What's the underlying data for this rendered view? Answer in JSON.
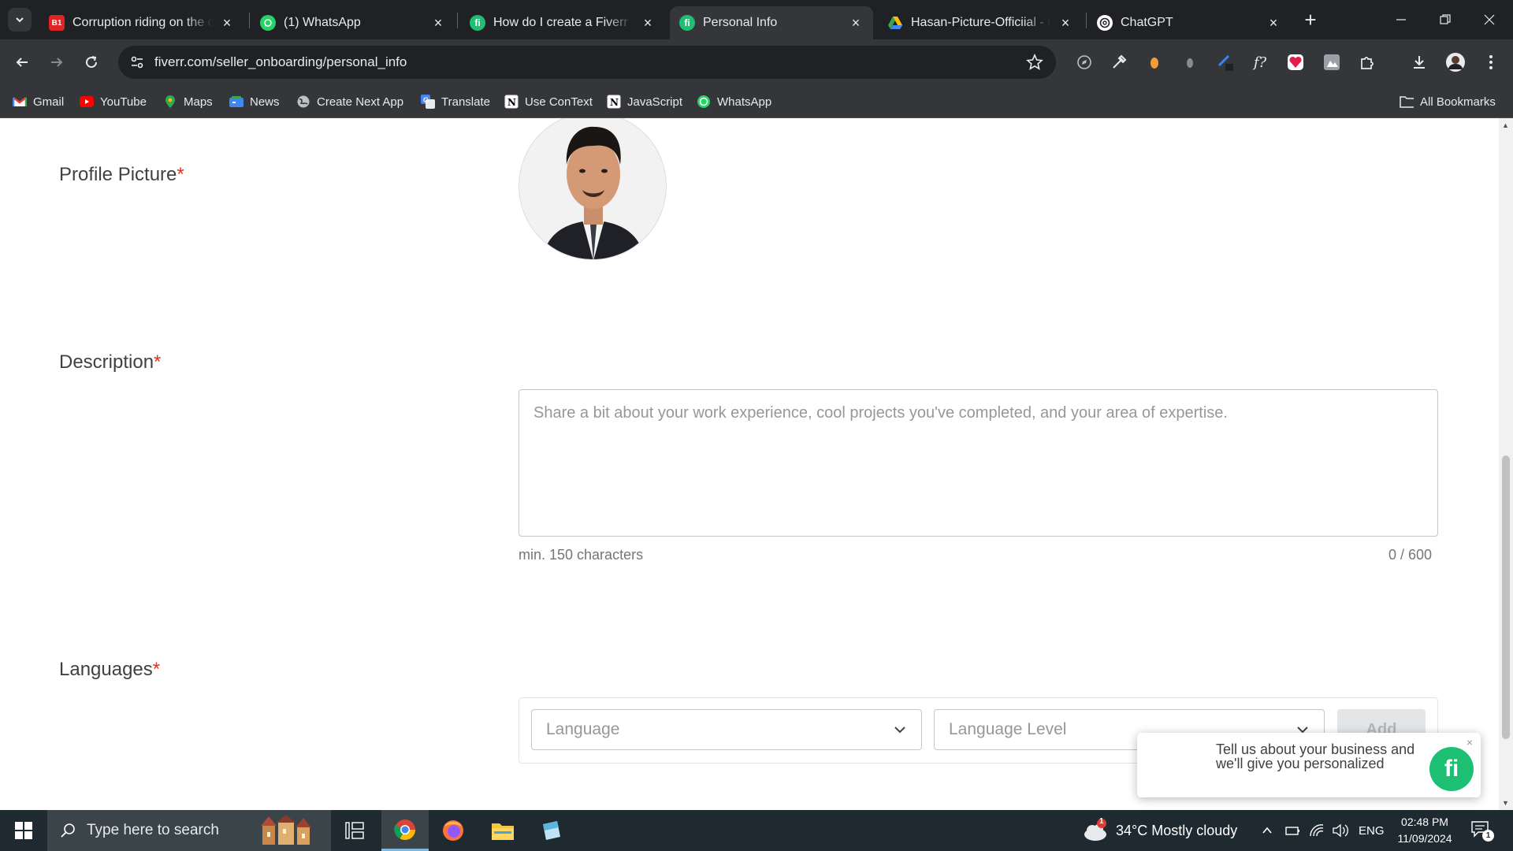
{
  "browser": {
    "tabs": [
      {
        "title": "Corruption riding on the coattails",
        "favicon": "b1-icon"
      },
      {
        "title": "(1) WhatsApp",
        "favicon": "whatsapp-icon"
      },
      {
        "title": "How do I create a Fiverr account",
        "favicon": "fiverr-icon"
      },
      {
        "title": "Personal Info",
        "favicon": "fiverr-icon",
        "active": true
      },
      {
        "title": "Hasan-Picture-Officiial - Google Drive",
        "favicon": "drive-icon"
      },
      {
        "title": "ChatGPT",
        "favicon": "chatgpt-icon"
      }
    ],
    "url": "fiverr.com/seller_onboarding/personal_info",
    "bookmarks": [
      "Gmail",
      "YouTube",
      "Maps",
      "News",
      "Create Next App",
      "Translate",
      "Use ConText",
      "JavaScript",
      "WhatsApp"
    ],
    "all_bookmarks": "All Bookmarks"
  },
  "form": {
    "profile_picture_label": "Profile Picture",
    "description_label": "Description",
    "description_placeholder": "Share a bit about your work experience, cool projects you've completed, and your area of expertise.",
    "description_min": "min. 150 characters",
    "description_counter": "0 / 600",
    "languages_label": "Languages",
    "required_mark": "*",
    "language_placeholder": "Language",
    "language_level_placeholder": "Language Level",
    "add_label": "Add"
  },
  "popup": {
    "text": "Tell us about your business and we'll give you personalized",
    "logo": "fi",
    "close": "×"
  },
  "taskbar": {
    "search_placeholder": "Type here to search",
    "weather": "34°C  Mostly cloudy",
    "weather_badge": "1",
    "language": "ENG",
    "time": "02:48 PM",
    "date": "11/09/2024",
    "notification_count": "1"
  },
  "colors": {
    "fiverr_green": "#1dbf73",
    "required_red": "#e0301e",
    "chrome_dark": "#202124",
    "chrome_toolbar": "#35363a"
  }
}
